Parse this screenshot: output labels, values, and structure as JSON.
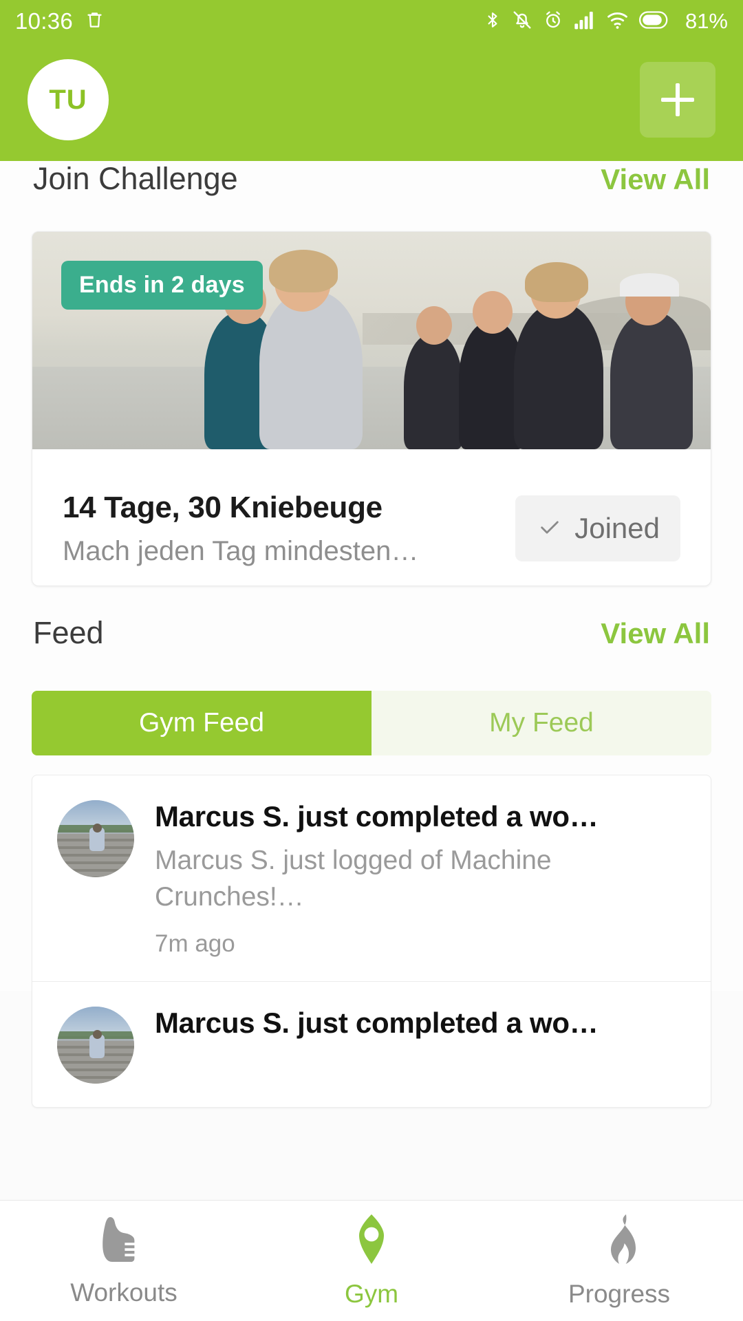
{
  "statusbar": {
    "time": "10:36",
    "battery_text": "81%",
    "icons": [
      "trash-icon",
      "bluetooth-icon",
      "silent-bell-icon",
      "alarm-icon",
      "signal-icon",
      "wifi-icon",
      "battery-icon"
    ]
  },
  "header": {
    "avatar_initials": "TU",
    "add_button_label": "+",
    "background_color": "#95c930"
  },
  "challenge_section": {
    "title": "Join Challenge",
    "view_all_label": "View All",
    "card": {
      "badge": "Ends in 2 days",
      "badge_color": "#3bae8d",
      "title": "14 Tage, 30 Kniebeuge",
      "subtitle": "Mach jeden Tag mindesten…",
      "button_label": "Joined",
      "button_icon": "check-icon"
    }
  },
  "feed_section": {
    "title": "Feed",
    "view_all_label": "View All",
    "tabs": [
      {
        "label": "Gym Feed",
        "active": true
      },
      {
        "label": "My Feed",
        "active": false
      }
    ],
    "items": [
      {
        "title": "Marcus S. just completed a wo…",
        "description": "Marcus S. just logged of Machine Crunches!…",
        "time": "7m ago"
      },
      {
        "title": "Marcus S. just completed a wo…",
        "description": "",
        "time": ""
      }
    ]
  },
  "bottom_nav": {
    "items": [
      {
        "label": "Workouts",
        "icon": "shoe-icon",
        "active": false
      },
      {
        "label": "Gym",
        "icon": "location-pin-icon",
        "active": true
      },
      {
        "label": "Progress",
        "icon": "flame-icon",
        "active": false
      }
    ],
    "active_color": "#8cc63f",
    "inactive_color": "#8a8a8a"
  }
}
